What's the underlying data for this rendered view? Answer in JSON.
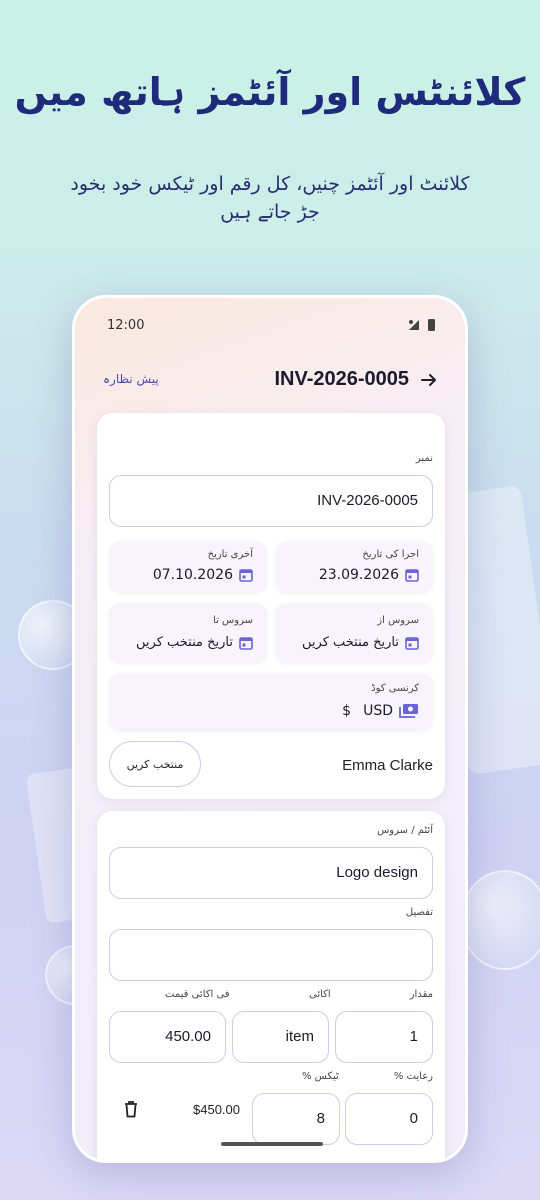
{
  "headline": "کلائنٹس اور آئٹمز ہاتھ میں",
  "subheadline": "کلائنٹ اور آئٹمز چنیں، کل رقم اور ٹیکس خود بخود جڑ جاتے ہیں",
  "status_bar": {
    "time": "12:00"
  },
  "appbar": {
    "title": "INV-2026-0005",
    "preview_label": "پیش نظارہ"
  },
  "invoice": {
    "number_label": "نمبر",
    "number_value": "INV-2026-0005",
    "issue_date_label": "اجرا کی تاریخ",
    "issue_date_value": "23.09.2026",
    "due_date_label": "آخری تاریخ",
    "due_date_value": "07.10.2026",
    "service_from_label": "سروس از",
    "service_from_value": "تاریخ منتخب کریں",
    "service_to_label": "سروس تا",
    "service_to_value": "تاریخ منتخب کریں",
    "currency_label": "کرنسی کوڈ",
    "currency_code": "USD",
    "currency_symbol": "$",
    "client_name": "Emma Clarke",
    "select_client_label": "منتخب کریں"
  },
  "item": {
    "name_label": "آئٹم / سروس",
    "name_value": "Logo design",
    "description_label": "تفصیل",
    "description_value": "",
    "quantity_label": "مقدار",
    "quantity_value": "1",
    "unit_label": "اکائی",
    "unit_value": "item",
    "unit_price_label": "فی اکائی قیمت",
    "unit_price_value": "450.00",
    "discount_label": "رعایت %",
    "discount_value": "0",
    "tax_label": "ٹیکس %",
    "tax_value": "8",
    "line_total": "$450.00"
  },
  "colors": {
    "accent": "#4c49b5",
    "headline": "#1f2a7a",
    "icon": "#6c63d9"
  }
}
